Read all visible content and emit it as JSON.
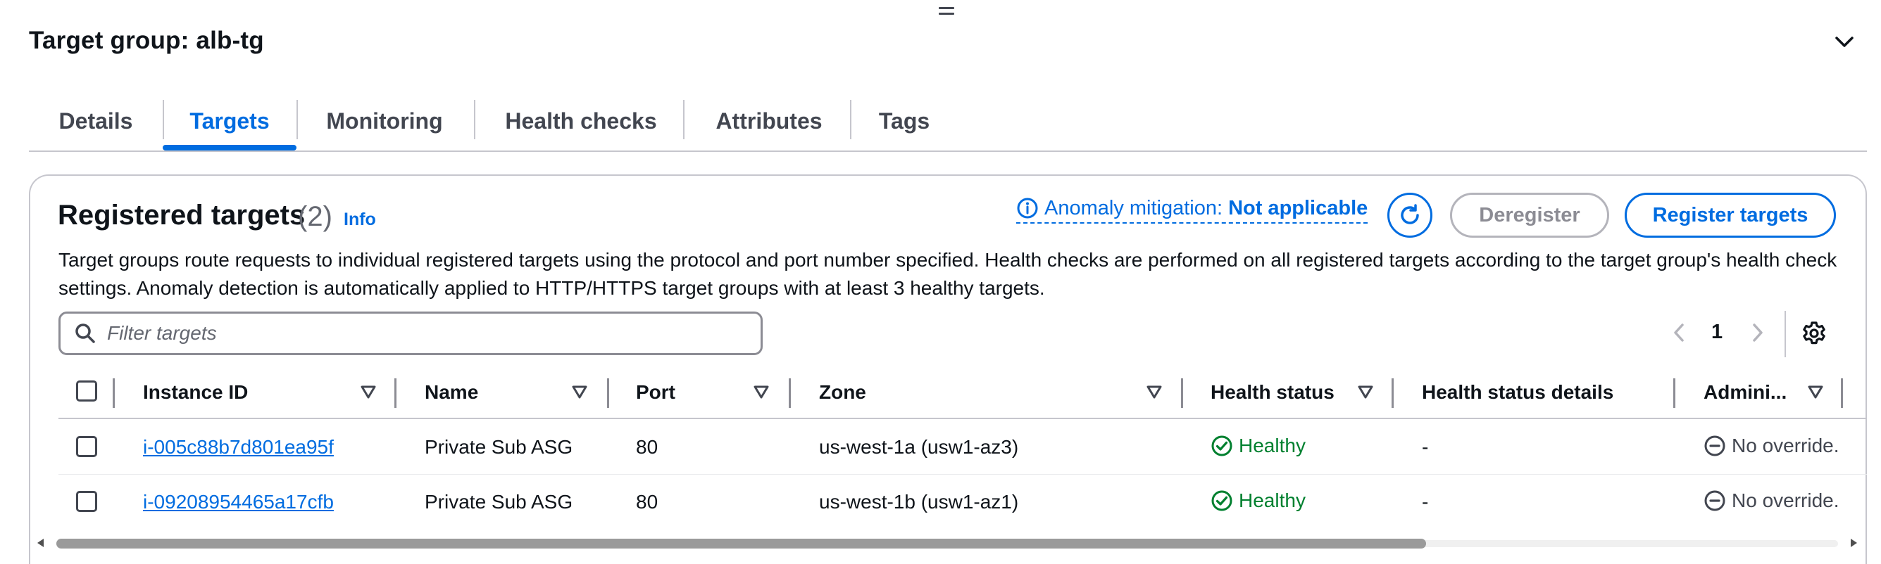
{
  "page": {
    "title": "Target group: alb-tg"
  },
  "tabs": [
    {
      "label": "Details",
      "active": false
    },
    {
      "label": "Targets",
      "active": true
    },
    {
      "label": "Monitoring",
      "active": false
    },
    {
      "label": "Health checks",
      "active": false
    },
    {
      "label": "Attributes",
      "active": false
    },
    {
      "label": "Tags",
      "active": false
    }
  ],
  "panel": {
    "title": "Registered targets",
    "count": "(2)",
    "info": "Info",
    "anomaly_label": "Anomaly mitigation:",
    "anomaly_value": "Not applicable",
    "deregister_label": "Deregister",
    "register_label": "Register targets",
    "description": "Target groups route requests to individual registered targets using the protocol and port number specified. Health checks are performed on all registered targets according to the target group's health check settings. Anomaly detection is automatically applied to HTTP/HTTPS target groups with at least 3 healthy targets."
  },
  "filter": {
    "placeholder": "Filter targets"
  },
  "pagination": {
    "current_page": "1"
  },
  "table": {
    "columns": [
      "Instance ID",
      "Name",
      "Port",
      "Zone",
      "Health status",
      "Health status details",
      "Admini..."
    ],
    "rows": [
      {
        "instance_id": "i-005c88b7d801ea95f",
        "name": "Private Sub ASG",
        "port": "80",
        "zone": "us-west-1a (usw1-az3)",
        "health": "Healthy",
        "health_details": "-",
        "admin": "No override."
      },
      {
        "instance_id": "i-09208954465a17cfb",
        "name": "Private Sub ASG",
        "port": "80",
        "zone": "us-west-1b (usw1-az1)",
        "health": "Healthy",
        "health_details": "-",
        "admin": "No override."
      }
    ]
  },
  "colors": {
    "accent": "#006ce0",
    "healthy": "#00802f",
    "border": "#c6c6cd"
  },
  "icons": [
    "drag-handle-icon",
    "chevron-down-icon",
    "info-circle-icon",
    "refresh-icon",
    "search-icon",
    "chevron-left-icon",
    "chevron-right-icon",
    "settings-gear-icon",
    "sort-caret-icon",
    "status-positive-icon",
    "status-stopped-icon"
  ]
}
